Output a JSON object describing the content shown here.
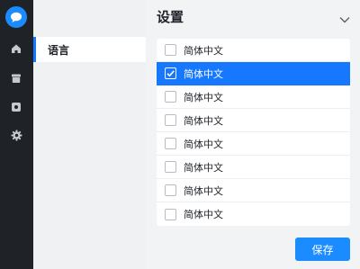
{
  "rail": {
    "icons": [
      "chat-bubble-icon",
      "home-icon",
      "archive-icon",
      "device-icon",
      "gear-icon"
    ]
  },
  "nav": {
    "items": [
      {
        "label": "语言",
        "active": true
      }
    ]
  },
  "main": {
    "title": "设置",
    "options": [
      {
        "label": "简体中文",
        "checked": false
      },
      {
        "label": "简体中文",
        "checked": true
      },
      {
        "label": "简体中文",
        "checked": false
      },
      {
        "label": "简体中文",
        "checked": false
      },
      {
        "label": "简体中文",
        "checked": false
      },
      {
        "label": "简体中文",
        "checked": false
      },
      {
        "label": "简体中文",
        "checked": false
      },
      {
        "label": "简体中文",
        "checked": false
      }
    ],
    "save_label": "保存"
  },
  "colors": {
    "accent": "#1677ff",
    "rail_bg": "#1f2327",
    "selected_text": "#ffffff"
  }
}
